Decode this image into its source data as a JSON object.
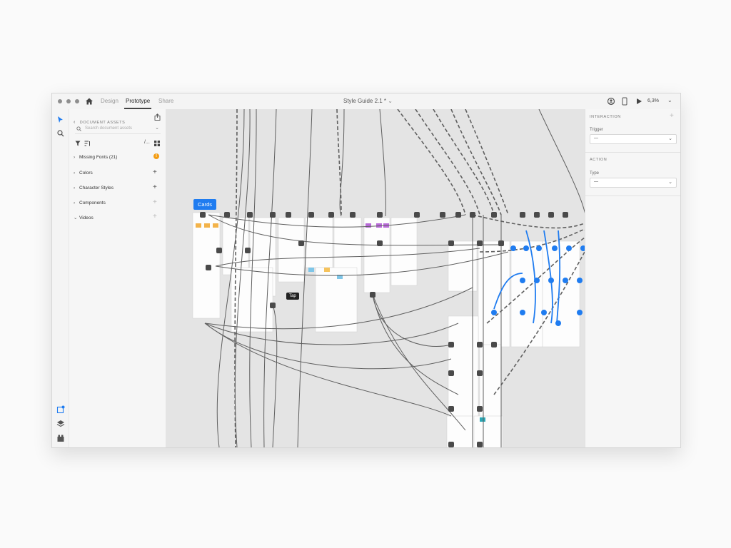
{
  "titlebar": {
    "tabs": [
      {
        "label": "Design",
        "active": false
      },
      {
        "label": "Prototype",
        "active": true
      },
      {
        "label": "Share",
        "active": false
      }
    ],
    "document_title": "Style Guide 2.1 *",
    "zoom": "6,3%"
  },
  "assets_panel": {
    "header": "DOCUMENT ASSETS",
    "search_placeholder": "Search document assets",
    "sections": [
      {
        "label": "Missing Fonts (21)",
        "expanded": false,
        "badge": "!"
      },
      {
        "label": "Colors",
        "expanded": false
      },
      {
        "label": "Character Styles",
        "expanded": false
      },
      {
        "label": "Components",
        "expanded": false
      },
      {
        "label": "Videos",
        "expanded": true
      }
    ]
  },
  "canvas": {
    "selected_artboard_label": "Cards",
    "trigger_label": "Tap"
  },
  "inspector": {
    "interaction_header": "INTERACTION",
    "trigger_label": "Trigger",
    "trigger_value": "—",
    "action_header": "ACTION",
    "type_label": "Type",
    "type_value": "—"
  },
  "colors": {
    "accent": "#1f7cf0",
    "wire": "#5f5f5f",
    "canvas_bg": "#e4e4e4",
    "warning": "#f39c12"
  }
}
